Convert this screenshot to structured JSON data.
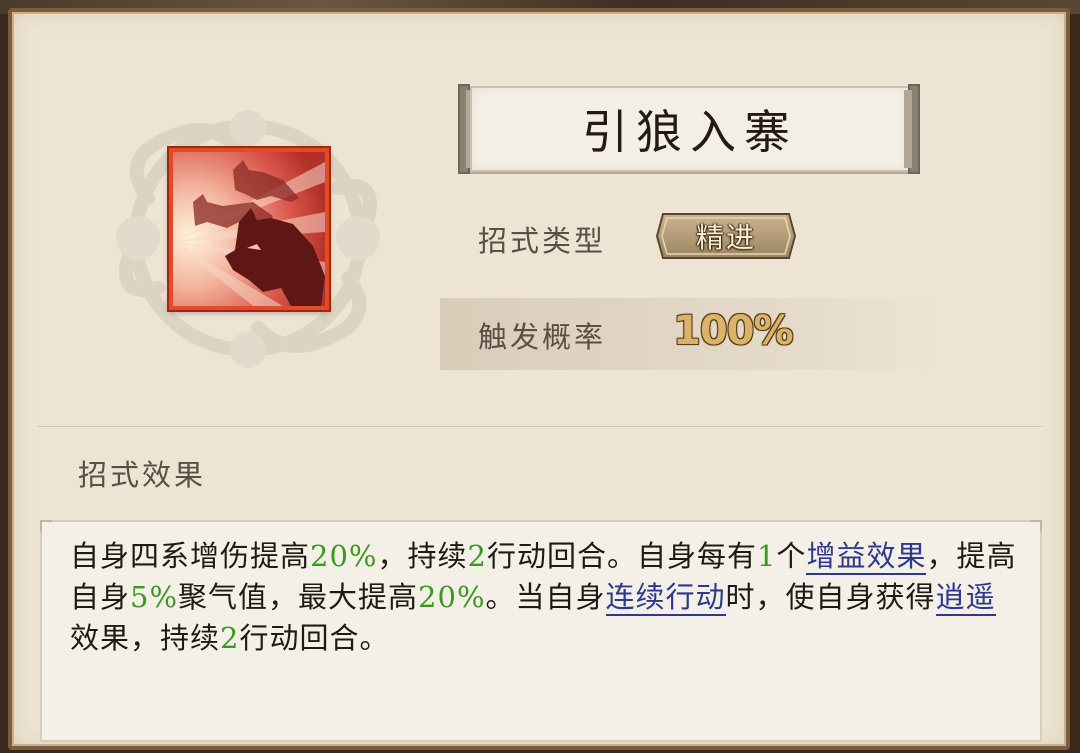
{
  "skill": {
    "name": "引狼入寨",
    "icon": "wolf-pack-skill-icon"
  },
  "type_row": {
    "label": "招式类型",
    "value": "精进"
  },
  "prob_row": {
    "label": "触发概率",
    "value": "100%"
  },
  "effect": {
    "section_label": "招式效果",
    "segments": [
      {
        "t": "自身四系增伤提高"
      },
      {
        "t": "20%",
        "g": 1
      },
      {
        "t": "，持续"
      },
      {
        "t": "2",
        "g": 1
      },
      {
        "t": "行动回合。自身每有"
      },
      {
        "t": "1",
        "g": 1
      },
      {
        "t": "个"
      },
      {
        "t": "增益效果",
        "k": 1
      },
      {
        "t": "，提高自身"
      },
      {
        "t": "5%",
        "g": 1
      },
      {
        "t": "聚气值，最大提高"
      },
      {
        "t": "20%",
        "g": 1
      },
      {
        "t": "。当自身"
      },
      {
        "t": "连续行动",
        "k": 1
      },
      {
        "t": "时，使自身获得"
      },
      {
        "t": "逍遥",
        "k": 1
      },
      {
        "t": "效果，持续"
      },
      {
        "t": "2",
        "g": 1
      },
      {
        "t": "行动回合。"
      }
    ]
  },
  "colors": {
    "highlight_green": "#3a9a1e",
    "keyword_blue": "#2d3a8c",
    "icon_border": "#e24a2a",
    "prob_gold": "#d9b36a"
  }
}
